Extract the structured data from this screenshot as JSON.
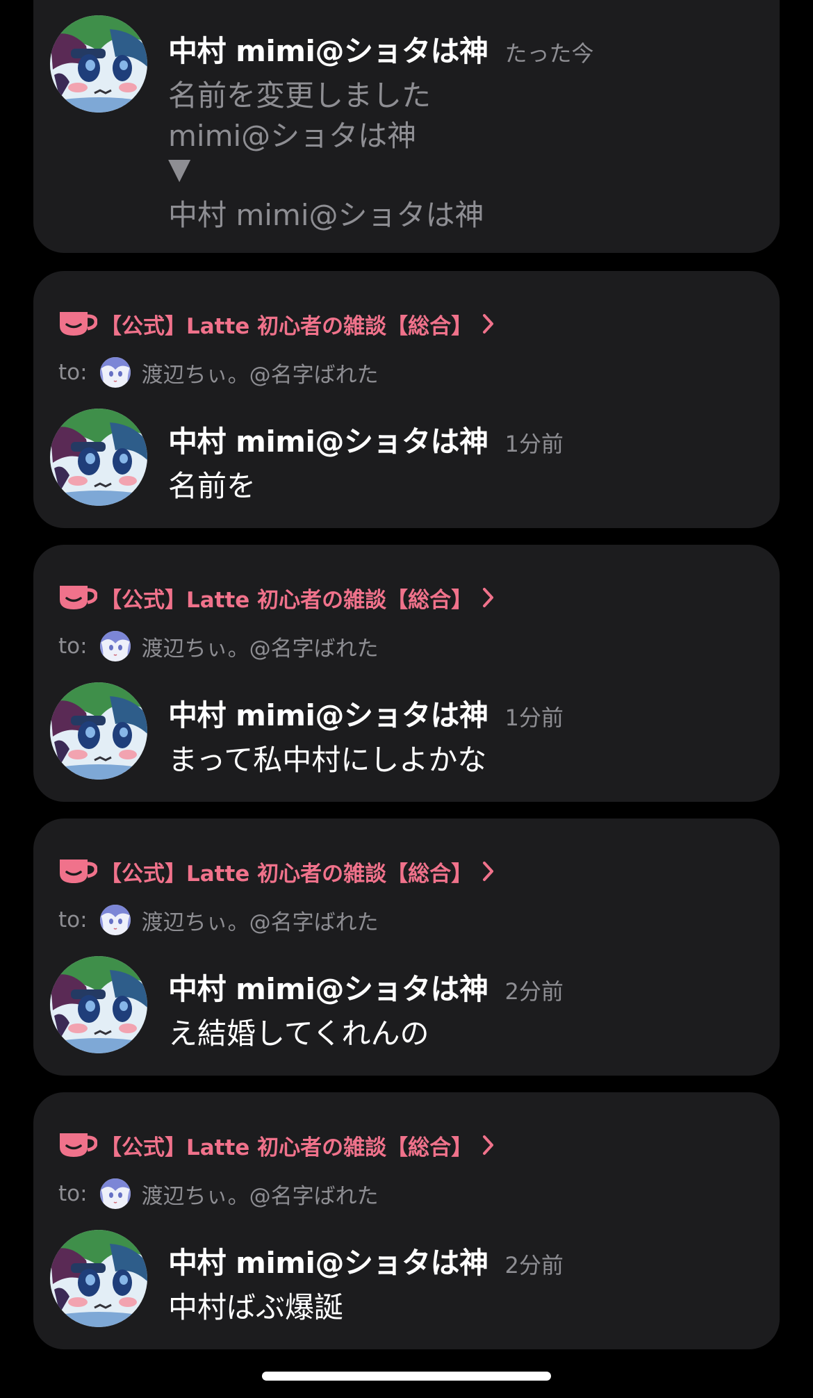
{
  "colors": {
    "background": "#000000",
    "card": "#1c1c1e",
    "accent_pink": "#f0728b",
    "secondary_text": "#8e8e93",
    "primary_text": "#ffffff"
  },
  "system_notice": {
    "sender": "中村 mimi@ショタは神",
    "time": "たった今",
    "lines": [
      "名前を変更しました",
      "mimi@ショタは神",
      "▼",
      "中村 mimi@ショタは神"
    ]
  },
  "messages": [
    {
      "room": "【公式】Latte 初心者の雑談【総合】",
      "to_prefix": "to:",
      "to_name": "渡辺ちぃ。@名字ばれた",
      "sender": "中村 mimi@ショタは神",
      "time": "1分前",
      "text": "名前を"
    },
    {
      "room": "【公式】Latte 初心者の雑談【総合】",
      "to_prefix": "to:",
      "to_name": "渡辺ちぃ。@名字ばれた",
      "sender": "中村 mimi@ショタは神",
      "time": "1分前",
      "text": "まって私中村にしよかな"
    },
    {
      "room": "【公式】Latte 初心者の雑談【総合】",
      "to_prefix": "to:",
      "to_name": "渡辺ちぃ。@名字ばれた",
      "sender": "中村 mimi@ショタは神",
      "time": "2分前",
      "text": "え結婚してくれんの"
    },
    {
      "room": "【公式】Latte 初心者の雑談【総合】",
      "to_prefix": "to:",
      "to_name": "渡辺ちぃ。@名字ばれた",
      "sender": "中村 mimi@ショタは神",
      "time": "2分前",
      "text": "中村ばぶ爆誕"
    }
  ],
  "icons": {
    "room": "coffee-cup-icon",
    "chevron": "chevron-right-icon"
  }
}
